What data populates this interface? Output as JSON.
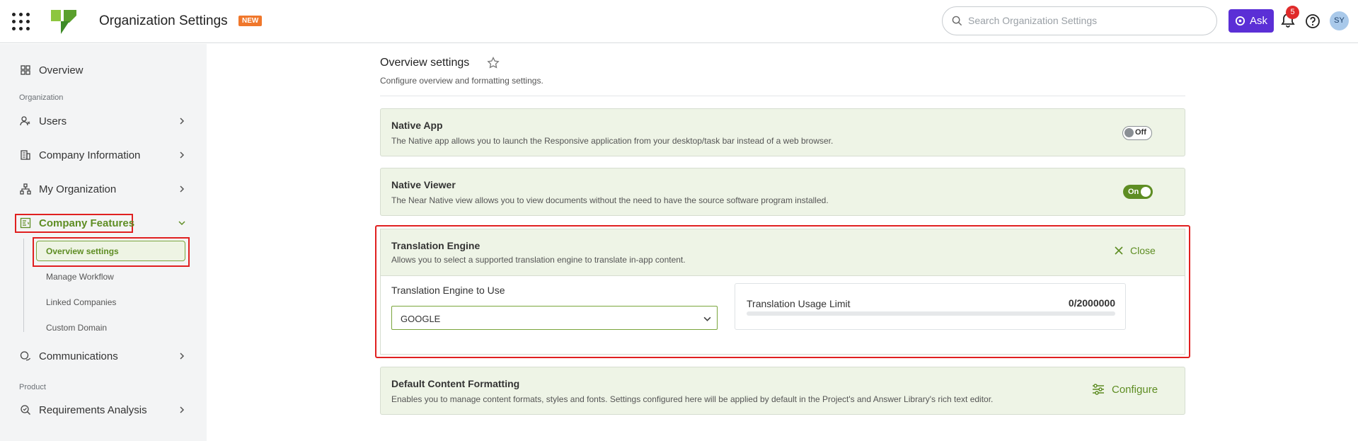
{
  "header": {
    "title": "Organization Settings",
    "new_badge": "NEW",
    "search_placeholder": "Search Organization Settings",
    "ask_label": "Ask",
    "notification_count": "5",
    "avatar_initials": "SY"
  },
  "sidebar": {
    "overview": "Overview",
    "section_organization": "Organization",
    "users": "Users",
    "company_information": "Company Information",
    "my_organization": "My Organization",
    "company_features": "Company Features",
    "sub_items": {
      "overview_settings": "Overview settings",
      "manage_workflow": "Manage Workflow",
      "linked_companies": "Linked Companies",
      "custom_domain": "Custom Domain"
    },
    "communications": "Communications",
    "section_product": "Product",
    "requirements_analysis": "Requirements Analysis"
  },
  "main": {
    "title": "Overview settings",
    "subtitle": "Configure overview and formatting settings.",
    "native_app": {
      "title": "Native App",
      "description": "The Native app allows you to launch the Responsive application from your desktop/task bar instead of a web browser.",
      "toggle_label": "Off"
    },
    "native_viewer": {
      "title": "Native Viewer",
      "description": "The Near Native view allows you to view documents without the need to have the source software program installed.",
      "toggle_label": "On"
    },
    "translation_engine": {
      "title": "Translation Engine",
      "description": "Allows you to select a supported translation engine to translate in-app content.",
      "close_label": "Close",
      "engine_label": "Translation Engine to Use",
      "engine_value": "GOOGLE",
      "usage_label": "Translation Usage Limit",
      "usage_value": "0/2000000",
      "usage_fraction": 0
    },
    "default_formatting": {
      "title": "Default Content Formatting",
      "description": "Enables you to manage content formats, styles and fonts. Settings configured here will be applied by default in the Project's and Answer Library's rich text editor.",
      "configure_label": "Configure"
    }
  },
  "colors": {
    "accent_green": "#5e8d23",
    "ask_purple": "#5b2fd6",
    "highlight_red": "#e02020"
  }
}
